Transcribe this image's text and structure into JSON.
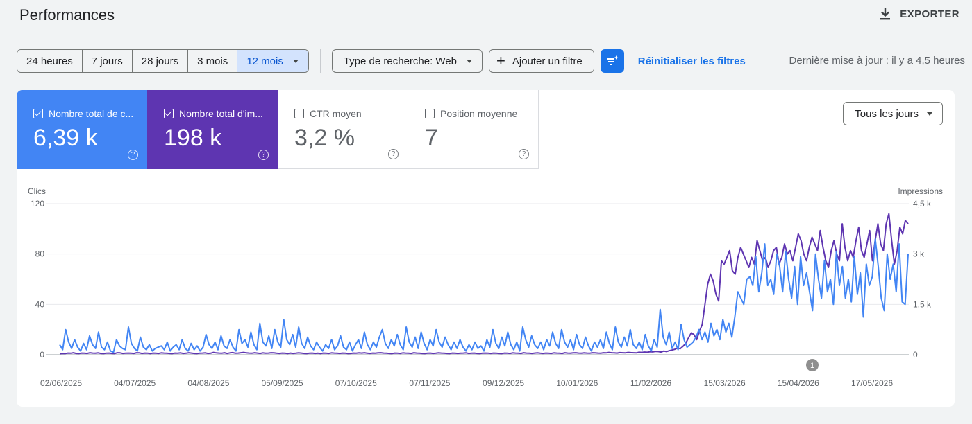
{
  "header": {
    "title": "Performances",
    "export_label": "EXPORTER",
    "export_icon": "download-icon"
  },
  "filters": {
    "ranges": [
      {
        "label": "24 heures",
        "active": false
      },
      {
        "label": "7 jours",
        "active": false
      },
      {
        "label": "28 jours",
        "active": false
      },
      {
        "label": "3 mois",
        "active": false
      },
      {
        "label": "12 mois",
        "active": true
      }
    ],
    "search_type_label": "Type de recherche: Web",
    "add_filter_label": "Ajouter un filtre",
    "filter_icon": "filter-sparkle-icon",
    "reset_label": "Réinitialiser les filtres",
    "last_update": "Dernière mise à jour : il y a 4,5 heures"
  },
  "metrics": [
    {
      "label": "Nombre total de c...",
      "value": "6,39 k",
      "checked": true,
      "color": "#4285f4"
    },
    {
      "label": "Nombre total d'im...",
      "value": "198 k",
      "checked": true,
      "color": "#5e35b1"
    },
    {
      "label": "CTR moyen",
      "value": "3,2 %",
      "checked": false
    },
    {
      "label": "Position moyenne",
      "value": "7",
      "checked": false
    }
  ],
  "days_dropdown_label": "Tous les jours",
  "chart_data": {
    "type": "line",
    "left_axis_label": "Clics",
    "right_axis_label": "Impressions",
    "left_ticks": [
      "0",
      "40",
      "80",
      "120"
    ],
    "left_ylim": [
      0,
      120
    ],
    "right_ticks": [
      "0",
      "1,5 k",
      "3 k",
      "4,5 k"
    ],
    "right_ylim": [
      0,
      4500
    ],
    "x_labels": [
      "02/06/2025",
      "04/07/2025",
      "04/08/2025",
      "05/09/2025",
      "07/10/2025",
      "07/11/2025",
      "09/12/2025",
      "10/01/2026",
      "11/02/2026",
      "15/03/2026",
      "15/04/2026",
      "17/05/2026"
    ],
    "annotation": "1",
    "grid": true,
    "series": [
      {
        "name": "Clics",
        "axis": "left",
        "color": "#4285f4",
        "values": [
          8,
          4,
          20,
          10,
          5,
          12,
          6,
          3,
          9,
          4,
          15,
          8,
          5,
          18,
          6,
          4,
          10,
          3,
          2,
          12,
          7,
          5,
          4,
          22,
          9,
          5,
          3,
          14,
          6,
          4,
          8,
          3,
          5,
          6,
          7,
          4,
          10,
          3,
          6,
          8,
          4,
          12,
          5,
          3,
          9,
          4,
          7,
          3,
          6,
          16,
          8,
          5,
          10,
          4,
          15,
          7,
          5,
          12,
          6,
          3,
          20,
          9,
          12,
          6,
          18,
          8,
          4,
          25,
          10,
          7,
          15,
          5,
          20,
          10,
          6,
          28,
          12,
          8,
          16,
          6,
          22,
          9,
          5,
          14,
          7,
          4,
          10,
          6,
          3,
          8,
          5,
          12,
          4,
          7,
          15,
          6,
          4,
          10,
          3,
          8,
          12,
          5,
          18,
          8,
          4,
          10,
          6,
          14,
          20,
          9,
          5,
          12,
          7,
          16,
          8,
          4,
          22,
          10,
          6,
          14,
          5,
          18,
          9,
          4,
          12,
          7,
          20,
          10,
          6,
          14,
          8,
          4,
          10,
          5,
          12,
          6,
          3,
          8,
          4,
          10,
          5,
          7,
          3,
          12,
          6,
          20,
          9,
          5,
          14,
          7,
          18,
          8,
          4,
          10,
          3,
          22,
          12,
          6,
          15,
          8,
          5,
          10,
          4,
          12,
          7,
          18,
          9,
          5,
          20,
          10,
          6,
          12,
          4,
          16,
          8,
          5,
          14,
          7,
          3,
          10,
          6,
          12,
          5,
          18,
          9,
          4,
          22,
          10,
          6,
          14,
          7,
          20,
          8,
          5,
          10,
          4,
          16,
          7,
          3,
          12,
          6,
          36,
          14,
          8,
          18,
          5,
          10,
          4,
          24,
          12,
          6,
          8,
          10,
          14,
          20,
          12,
          18,
          10,
          25,
          15,
          20,
          12,
          28,
          18,
          25,
          14,
          30,
          50,
          45,
          40,
          60,
          62,
          55,
          78,
          50,
          65,
          88,
          55,
          60,
          48,
          80,
          70,
          50,
          82,
          60,
          45,
          70,
          40,
          78,
          55,
          65,
          50,
          35,
          80,
          60,
          45,
          75,
          50,
          60,
          40,
          82,
          55,
          70,
          45,
          60,
          42,
          78,
          48,
          65,
          30,
          72,
          55,
          62,
          92,
          70,
          45,
          35,
          80,
          60,
          72,
          50,
          88,
          42,
          40,
          80
        ]
      },
      {
        "name": "Impressions",
        "axis": "right",
        "color": "#5e35b1",
        "values": [
          30,
          40,
          35,
          50,
          45,
          60,
          40,
          35,
          50,
          45,
          40,
          60,
          50,
          45,
          55,
          40,
          35,
          45,
          50,
          40,
          35,
          60,
          55,
          40,
          45,
          50,
          45,
          40,
          60,
          55,
          40,
          50,
          45,
          35,
          50,
          45,
          40,
          55,
          50,
          45,
          40,
          35,
          50,
          45,
          55,
          40,
          45,
          60,
          50,
          40,
          35,
          45,
          50,
          55,
          40,
          45,
          70,
          55,
          50,
          45,
          60,
          40,
          55,
          65,
          45,
          50,
          60,
          70,
          55,
          50,
          45,
          60,
          50,
          40,
          55,
          45,
          50,
          60,
          55,
          45,
          40,
          50,
          45,
          35,
          50,
          40,
          45,
          55,
          50,
          40,
          35,
          45,
          50,
          40,
          45,
          35,
          50,
          45,
          40,
          55,
          50,
          45,
          40,
          50,
          45,
          35,
          40,
          50,
          45,
          55,
          50,
          60,
          45,
          40,
          50,
          45,
          55,
          60,
          50,
          45,
          40,
          35,
          50,
          45,
          40,
          55,
          50,
          45,
          40,
          60,
          50,
          45,
          40,
          35,
          45,
          50,
          40,
          45,
          55,
          50,
          45,
          40,
          35,
          50,
          45,
          40,
          45,
          50,
          55,
          40,
          45,
          50,
          40,
          35,
          45,
          50,
          45,
          40,
          50,
          45,
          40,
          35,
          50,
          45,
          40,
          55,
          50,
          45,
          40,
          60,
          50,
          45,
          40,
          50,
          55,
          45,
          40,
          50,
          45,
          40,
          55,
          50,
          45,
          40,
          60,
          50,
          45,
          55,
          60,
          50,
          45,
          55,
          50,
          45,
          60,
          55,
          50,
          45,
          60,
          55,
          70,
          60,
          55,
          50,
          65,
          60,
          55,
          70,
          65,
          60,
          55,
          75,
          70,
          80,
          75,
          90,
          85,
          100,
          95,
          80,
          110,
          95,
          120,
          140,
          160,
          200,
          180,
          250,
          340,
          500,
          650,
          600,
          450,
          700,
          900,
          1500,
          2100,
          2400,
          2200,
          1800,
          1600,
          2800,
          2700,
          2900,
          3100,
          2500,
          2400,
          2900,
          3200,
          3000,
          2800,
          2600,
          2900,
          2700,
          3400,
          3100,
          2800,
          2900,
          2600,
          2800,
          3100,
          3200,
          2700,
          2900,
          3300,
          3000,
          3100,
          2800,
          3200,
          3600,
          3400,
          3000,
          2800,
          3200,
          3500,
          3300,
          3100,
          3700,
          3200,
          2800,
          2600,
          3100,
          3400,
          3000,
          2800,
          3900,
          3200,
          2800,
          3100,
          2900,
          3400,
          3800,
          3100,
          2900,
          3300,
          3700,
          2800,
          3400,
          3900,
          3300,
          3100,
          3900,
          4200,
          3400,
          2700,
          3100,
          3800,
          3600,
          4000,
          3900
        ]
      }
    ]
  }
}
